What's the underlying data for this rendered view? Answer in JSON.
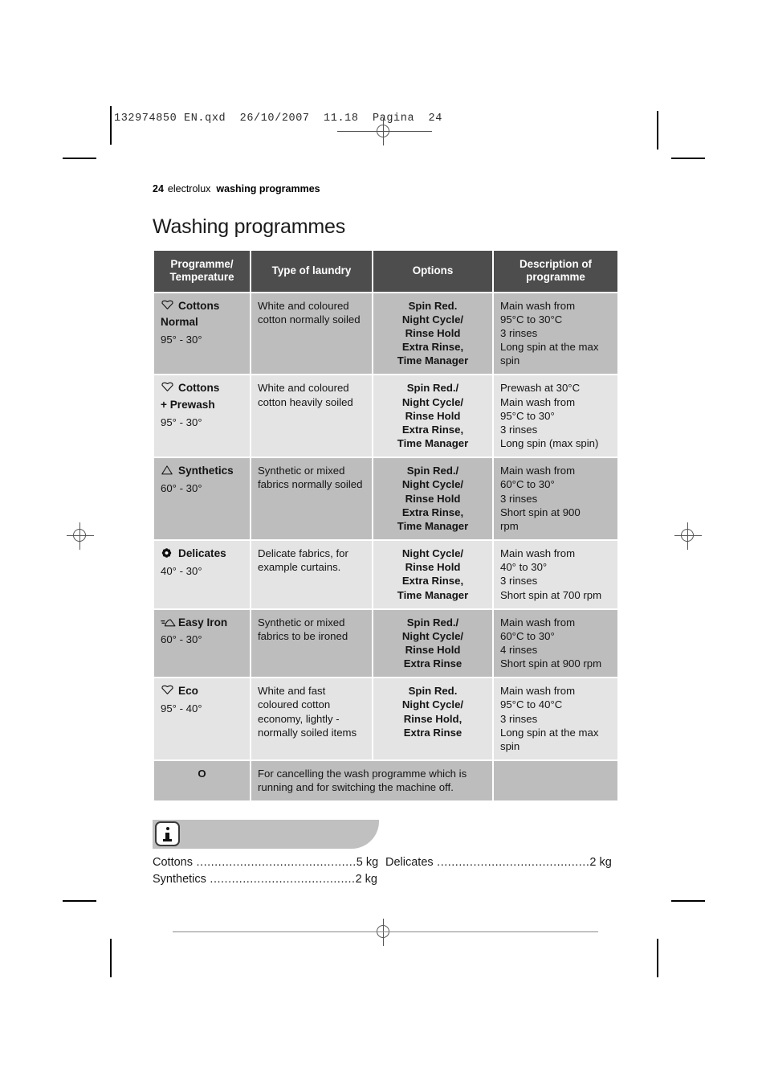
{
  "print_marks": {
    "file_stamp": "132974850 EN.qxd  26/10/2007  11.18  Pagina  24"
  },
  "running_head": {
    "page_number": "24",
    "brand": "electrolux",
    "section": "washing programmes"
  },
  "title": "Washing programmes",
  "table": {
    "headers": [
      "Programme/\nTemperature",
      "Type of laundry",
      "Options",
      "Description of\nprogramme"
    ],
    "header_lines": {
      "h1a": "Programme/",
      "h1b": "Temperature",
      "h2": "Type of laundry",
      "h3": "Options",
      "h4a": "Description of",
      "h4b": "programme"
    },
    "rows": [
      {
        "icon": "cotton-tub-icon",
        "name": "Cottons",
        "name2": "Normal",
        "temperature": "95° - 30°",
        "type_of_laundry": "White and coloured cotton normally soiled",
        "options": "Spin Red.\nNight Cycle/\nRinse Hold\nExtra Rinse,\nTime Manager",
        "options_lines": [
          "Spin Red.",
          "Night Cycle/",
          "Rinse Hold",
          "Extra Rinse,",
          "Time Manager"
        ],
        "description": "Main wash from 95°C to 30°C\n3 rinses\nLong spin at the max spin",
        "description_lines": [
          "Main wash from",
          "95°C to 30°C",
          "3 rinses",
          "Long spin at the max",
          "spin"
        ],
        "shade": "dark"
      },
      {
        "icon": "cotton-tub-icon",
        "name": "Cottons",
        "name2": "+ Prewash",
        "temperature": "95° - 30°",
        "type_of_laundry": "White and coloured cotton heavily soiled",
        "options": "Spin Red./\nNight Cycle/\nRinse Hold\nExtra Rinse,\nTime Manager",
        "options_lines": [
          "Spin Red./",
          "Night Cycle/",
          "Rinse Hold",
          "Extra Rinse,",
          "Time Manager"
        ],
        "description": "Prewash at 30°C\nMain wash from 95°C to 30°\n3 rinses\nLong spin (max spin)",
        "description_lines": [
          "Prewash at 30°C",
          "Main wash from",
          "95°C to 30°",
          "3 rinses",
          "Long spin (max spin)"
        ],
        "shade": "light"
      },
      {
        "icon": "synthetics-triangle-icon",
        "name": "Synthetics",
        "name2": "",
        "temperature": "60° - 30°",
        "type_of_laundry": "Synthetic or mixed fabrics normally soiled",
        "options": "Spin Red./\nNight Cycle/\nRinse Hold\nExtra Rinse,\nTime Manager",
        "options_lines": [
          "Spin Red./",
          "Night Cycle/",
          "Rinse Hold",
          "Extra Rinse,",
          "Time Manager"
        ],
        "description": "Main wash from 60°C to 30°\n3 rinses\nShort spin at 900 rpm",
        "description_lines": [
          "Main wash from",
          "60°C to 30°",
          "3 rinses",
          "Short spin at 900",
          "rpm"
        ],
        "shade": "dark"
      },
      {
        "icon": "delicates-flower-icon",
        "name": "Delicates",
        "name2": "",
        "temperature": "40° - 30°",
        "type_of_laundry": "Delicate fabrics, for example curtains.",
        "options": "Night Cycle/\nRinse Hold\nExtra Rinse,\nTime Manager",
        "options_lines": [
          "Night Cycle/",
          "Rinse Hold",
          "Extra Rinse,",
          "Time Manager"
        ],
        "description": "Main wash from 40° to 30°\n3 rinses\nShort spin at 700 rpm",
        "description_lines": [
          "Main wash from",
          "40° to 30°",
          "3 rinses",
          "Short spin at 700 rpm"
        ],
        "shade": "light"
      },
      {
        "icon": "easy-iron-icon",
        "name": "Easy Iron",
        "name2": "",
        "temperature": "60° - 30°",
        "type_of_laundry": "Synthetic or mixed fabrics to be ironed",
        "options": "Spin Red./\nNight Cycle/\nRinse Hold\nExtra Rinse",
        "options_lines": [
          "Spin Red./",
          "Night Cycle/",
          "Rinse Hold",
          "Extra Rinse"
        ],
        "description": "Main wash from 60°C to 30°\n4 rinses\nShort spin at 900 rpm",
        "description_lines": [
          "Main wash from",
          "60°C to 30°",
          "4 rinses",
          "Short spin at 900 rpm"
        ],
        "shade": "dark"
      },
      {
        "icon": "cotton-tub-icon",
        "name": "Eco",
        "name2": "",
        "temperature": "95° - 40°",
        "type_of_laundry": "White and fast coloured cotton economy, lightly - normally soiled items",
        "options": "Spin Red.\nNight Cycle/\nRinse Hold,\nExtra Rinse",
        "options_lines": [
          "Spin Red.",
          "Night Cycle/",
          "Rinse Hold,",
          "Extra Rinse"
        ],
        "description": "Main wash from 95°C to 40°C\n3 rinses\nLong spin at the max spin",
        "description_lines": [
          "Main wash from",
          "95°C to 40°C",
          "3 rinses",
          "Long spin at the max",
          "spin"
        ],
        "shade": "light"
      }
    ],
    "off_row": {
      "symbol": "O",
      "text": "For cancelling the wash programme which is running and for switching the machine off.",
      "shade": "dark"
    }
  },
  "note": {
    "icon": "info-icon",
    "loads": [
      {
        "label": "Cottons",
        "dots": " ............................................",
        "value": "5 kg"
      },
      {
        "label": "Synthetics",
        "dots": " ........................................",
        "value": "2 kg"
      },
      {
        "label": "Delicates",
        "dots": " ..........................................",
        "value": "2 kg"
      }
    ]
  },
  "colors": {
    "header_bg": "#4d4d4d",
    "row_dark": "#bdbdbd",
    "row_light": "#e4e4e4",
    "note_band": "#c0c0c0",
    "text": "#141414"
  }
}
